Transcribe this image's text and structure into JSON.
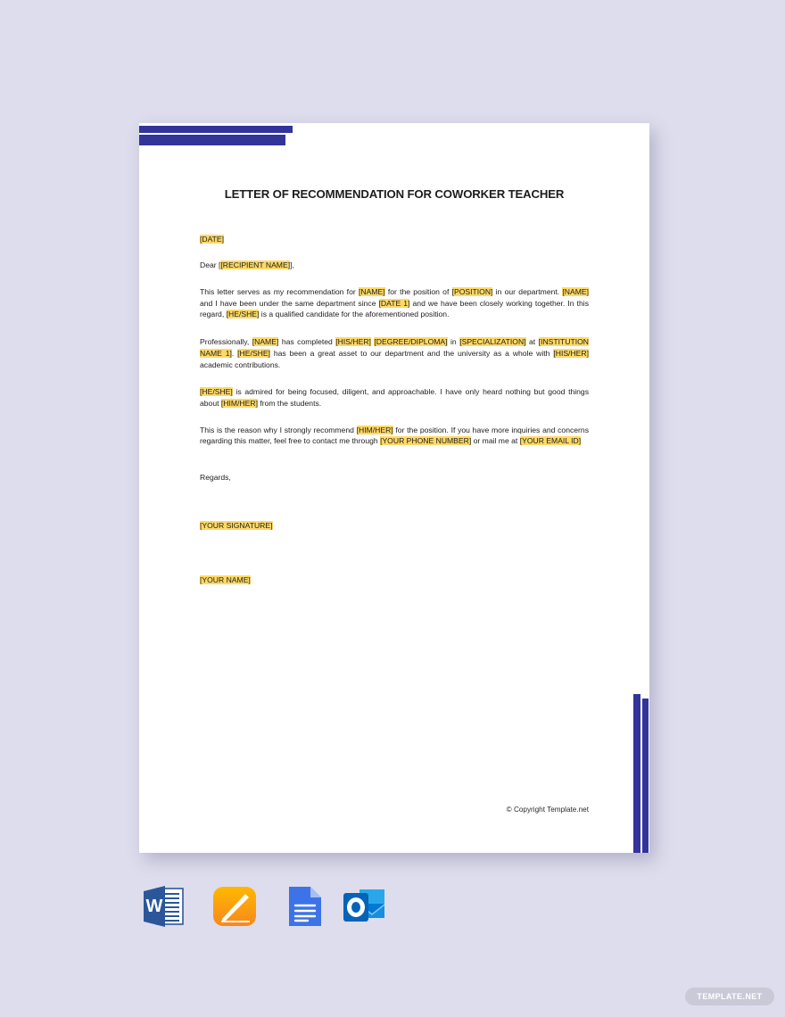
{
  "background_color": "#dedded",
  "document": {
    "page_background": "#ffffff",
    "accent_color": "#33349a",
    "highlight_color": "#ffd966",
    "title": "LETTER OF RECOMMENDATION FOR COWORKER TEACHER",
    "paragraphs": {
      "date": {
        "placeholder": "[DATE]"
      },
      "salutation": {
        "prefix": "Dear ",
        "placeholder": "[RECIPIENT NAME]",
        "suffix": ","
      },
      "intro": {
        "s1": "This letter serves as my recommendation for ",
        "name1": "[NAME]",
        "s2": " for the position of ",
        "position": "[POSITION]",
        "s3": " in our department. ",
        "name2": "[NAME]",
        "s4": " and I have been under the same department since ",
        "date1": "[DATE 1]",
        "s5": " and we have been closely working together. In this regard, ",
        "heshe": "[HE/SHE]",
        "s6": " is a qualified candidate for the aforementioned position."
      },
      "professional": {
        "s1": "Professionally, ",
        "name": "[NAME]",
        "s2": " has completed ",
        "hisher1": "[HIS/HER]",
        "s3": " ",
        "degree": "[DEGREE/DIPLOMA]",
        "s4": " in ",
        "specialization": "[SPECIALIZATION]",
        "s5": " at ",
        "institution": "[INSTITUTION NAME 1]",
        "s6": ". ",
        "heshe": "[HE/SHE]",
        "s7": " has been a great asset to our department and the university as a whole with ",
        "hisher2": "[HIS/HER]",
        "s8": " academic contributions."
      },
      "admired": {
        "heshe": "[HE/SHE]",
        "s1": " is admired for being focused, diligent, and approachable. I have only heard nothing but good things about ",
        "himher": "[HIM/HER]",
        "s2": " from the students."
      },
      "reason": {
        "s1": "This is the reason why I strongly recommend ",
        "himher": "[HIM/HER]",
        "s2": " for the position. If you have more inquiries and concerns regarding this matter, feel free to contact me through ",
        "phone": "[YOUR PHONE NUMBER]",
        "s3": " or mail me at ",
        "email": "[YOUR EMAIL ID]"
      },
      "regards": "Regards,",
      "signature": "[YOUR SIGNATURE]",
      "your_name": "[YOUR NAME]"
    },
    "copyright": "© Copyright Template.net"
  },
  "file_formats": [
    {
      "name": "microsoft-word",
      "label": "MS Word"
    },
    {
      "name": "apple-pages",
      "label": "Apple Pages"
    },
    {
      "name": "google-docs",
      "label": "Google Docs"
    },
    {
      "name": "microsoft-outlook",
      "label": "Outlook"
    }
  ],
  "watermark": {
    "label": "TEMPLATE.NET",
    "background": "#c9c9d8",
    "text_color": "#ffffff"
  }
}
